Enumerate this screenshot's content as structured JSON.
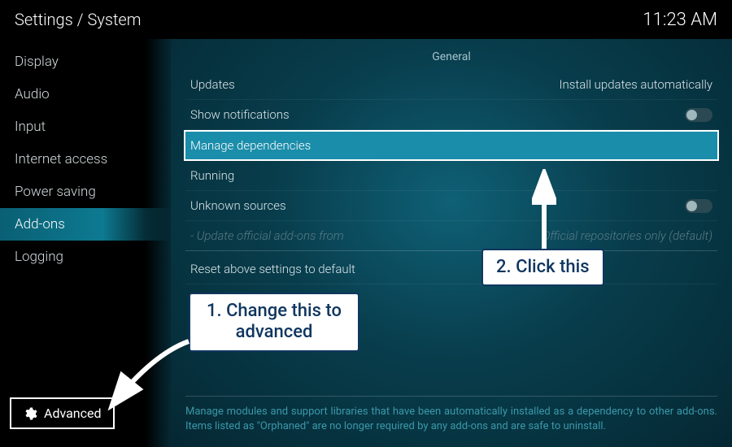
{
  "header": {
    "title": "Settings / System",
    "clock": "11:23 AM"
  },
  "sidebar": {
    "items": [
      {
        "label": "Display"
      },
      {
        "label": "Audio"
      },
      {
        "label": "Input"
      },
      {
        "label": "Internet access"
      },
      {
        "label": "Power saving"
      },
      {
        "label": "Add-ons",
        "active": true
      },
      {
        "label": "Logging"
      }
    ],
    "level_button": "Advanced"
  },
  "main": {
    "section_label": "General",
    "rows": {
      "updates": {
        "label": "Updates",
        "value": "Install updates automatically"
      },
      "notifications": {
        "label": "Show notifications"
      },
      "manage_deps": {
        "label": "Manage dependencies"
      },
      "running": {
        "label": "Running"
      },
      "unknown": {
        "label": "Unknown sources"
      },
      "update_from": {
        "label": "- Update official add-ons from",
        "value": "Official repositories only (default)"
      },
      "reset": {
        "label": "Reset above settings to default"
      }
    },
    "help": "Manage modules and support libraries that have been automatically installed as a dependency to other add-ons. Items listed as \"Orphaned\" are no longer required by any add-ons and are safe to uninstall."
  },
  "annotations": {
    "callout1": "1. Change this to advanced",
    "callout2": "2. Click this"
  }
}
